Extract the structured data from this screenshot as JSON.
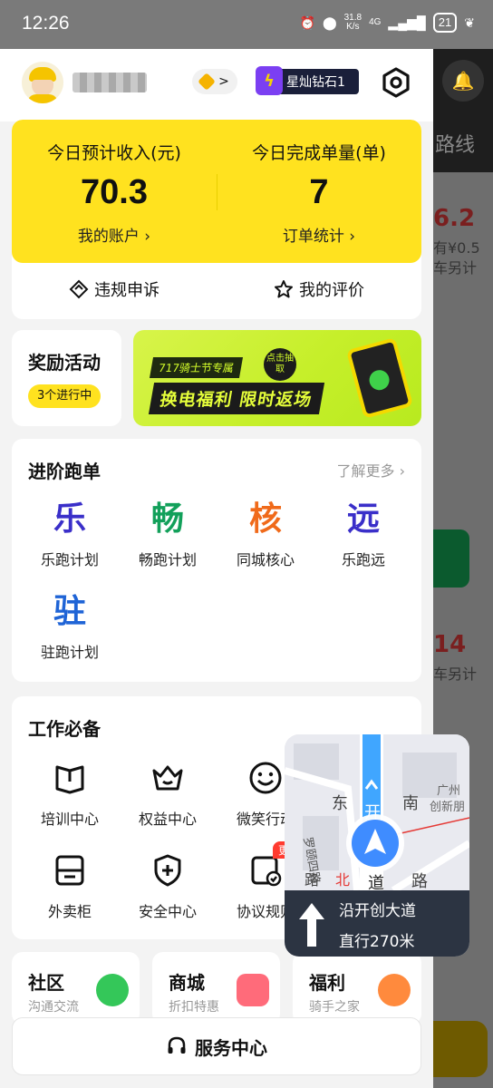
{
  "status_bar": {
    "time": "12:26",
    "speed_top": "31.8",
    "speed_unit": "K/s",
    "network": "4G",
    "battery": "21"
  },
  "header": {
    "level_label": "星灿钻石1",
    "coin_chevron": ">"
  },
  "income": {
    "left_title": "今日预计收入(元)",
    "left_value": "70.3",
    "left_link": "我的账户",
    "right_title": "今日完成单量(单)",
    "right_value": "7",
    "right_link": "订单统计",
    "appeal": "违规申诉",
    "review": "我的评价"
  },
  "rewards": {
    "title": "奖励活动",
    "badge": "3个进行中",
    "banner_tag": "717骑士节专属",
    "banner_main": "换电福利 限时返场",
    "banner_click": "点击抽取"
  },
  "advanced": {
    "title": "进阶跑单",
    "more": "了解更多",
    "items": [
      {
        "glyph": "乐",
        "label": "乐跑计划",
        "color": "#3a2fc9"
      },
      {
        "glyph": "畅",
        "label": "畅跑计划",
        "color": "#12a05a"
      },
      {
        "glyph": "核",
        "label": "同城核心",
        "color": "#f06a1a"
      },
      {
        "glyph": "远",
        "label": "乐跑远",
        "color": "#3a2fc9"
      },
      {
        "glyph": "驻",
        "label": "驻跑计划",
        "color": "#1f64d6"
      }
    ]
  },
  "work": {
    "title": "工作必备",
    "items": [
      {
        "label": "培训中心",
        "icon": "book-icon"
      },
      {
        "label": "权益中心",
        "icon": "crown-icon"
      },
      {
        "label": "微笑行动",
        "icon": "smile-icon"
      },
      {
        "label": "外卖柜",
        "icon": "locker-icon"
      },
      {
        "label": "安全中心",
        "icon": "shield-icon"
      },
      {
        "label": "协议规则",
        "icon": "agreement-icon",
        "badge": "更新"
      }
    ]
  },
  "bottom": {
    "community": {
      "title": "社区",
      "sub": "沟通交流"
    },
    "mall": {
      "title": "商城",
      "sub": "折扣特惠"
    },
    "welfare": {
      "title": "福利",
      "sub": "骑手之家"
    }
  },
  "service": {
    "label": "服务中心"
  },
  "navigation": {
    "road": "沿开创大道",
    "distance": "直行270米",
    "map_labels": [
      "东",
      "开",
      "南",
      "道",
      "路",
      "路",
      "北",
      "罗颐四路",
      "广州",
      "创新朋"
    ]
  },
  "background": {
    "route": "路线",
    "amount_a": "6.2",
    "sub_a": "有¥0.5",
    "sub_b": "车另计",
    "amount_b": "14",
    "sub_c": "车另计"
  }
}
